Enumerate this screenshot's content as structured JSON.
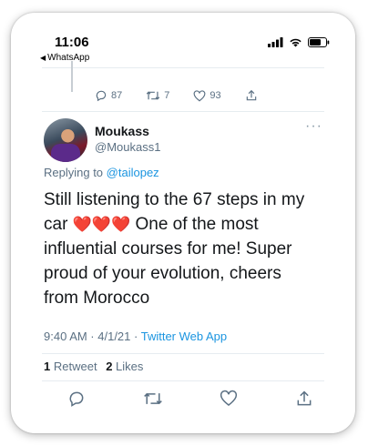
{
  "status_bar": {
    "time": "11:06",
    "back_app": "WhatsApp",
    "back_arrow_icon": "back-triangle-icon",
    "icons": [
      "cellular-signal-icon",
      "wifi-icon",
      "battery-icon"
    ]
  },
  "previous_tweet_actions": {
    "reply_count": "87",
    "retweet_count": "7",
    "like_count": "93"
  },
  "tweet": {
    "display_name": "Moukass",
    "handle": "@Moukass1",
    "replying_to_prefix": "Replying to",
    "replying_to_handle": "@tailopez",
    "text_part1": "Still listening to the 67 steps in my car",
    "hearts": "❤️❤️❤️",
    "text_part2": "One of the most influential courses for me! Super proud of your evolution, cheers from Morocco",
    "timestamp": "9:40 AM · 4/1/21 · ",
    "source": "Twitter Web App",
    "retweets": "1",
    "retweets_label": "Retweet",
    "likes": "2",
    "likes_label": "Likes"
  },
  "colors": {
    "accent": "#1b95e0",
    "secondary_text": "#5b7083",
    "heart": "#e0245e"
  }
}
